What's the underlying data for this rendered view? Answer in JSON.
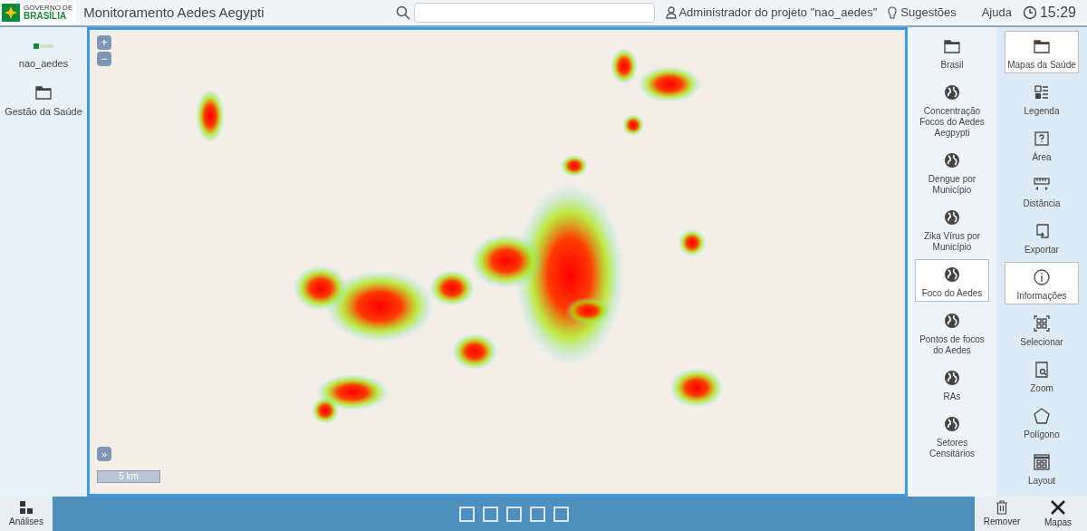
{
  "header": {
    "logo_top": "GOVERNO DE",
    "logo_bottom": "BRASÍLIA",
    "title": "Monitoramento Aedes Aegypti",
    "user": "Administrador do projeto \"nao_aedes\"",
    "suggestions": "Sugestões",
    "help": "Ajuda",
    "time": "15:29"
  },
  "sidebar": {
    "project": "nao_aedes",
    "items": [
      {
        "label": "Gestão da Saúde",
        "kind": "folder"
      }
    ]
  },
  "map": {
    "zoom_in": "+",
    "zoom_out": "−",
    "expand": "»",
    "scale": "5 km"
  },
  "layers": [
    {
      "label": "Brasil",
      "kind": "folder",
      "selected": false
    },
    {
      "label": "Concentração Focos do Aedes Aegpypti",
      "kind": "layer",
      "selected": false
    },
    {
      "label": "Dengue por Município",
      "kind": "layer",
      "selected": false
    },
    {
      "label": "Zika Vírus por Município",
      "kind": "layer",
      "selected": false
    },
    {
      "label": "Foco do Aedes",
      "kind": "layer",
      "selected": true
    },
    {
      "label": "Pontos de focos do Aedes",
      "kind": "layer",
      "selected": false
    },
    {
      "label": "RAs",
      "kind": "layer",
      "selected": false
    },
    {
      "label": "Setores Censitários",
      "kind": "layer",
      "selected": false
    }
  ],
  "tools": [
    {
      "label": "Mapas da Saúde",
      "kind": "folder",
      "selected": true
    },
    {
      "label": "Legenda",
      "kind": "legend",
      "selected": false
    },
    {
      "label": "Área",
      "kind": "area",
      "selected": false
    },
    {
      "label": "Distância",
      "kind": "distance",
      "selected": false
    },
    {
      "label": "Exportar",
      "kind": "export",
      "selected": false
    },
    {
      "label": "Informações",
      "kind": "info",
      "selected": true
    },
    {
      "label": "Selecionar",
      "kind": "select",
      "selected": false
    },
    {
      "label": "Zoom",
      "kind": "zoom",
      "selected": false
    },
    {
      "label": "Polígono",
      "kind": "polygon",
      "selected": false
    },
    {
      "label": "Layout",
      "kind": "layout",
      "selected": false
    }
  ],
  "footer": {
    "analyses": "Análises",
    "pages": [
      {
        "selected": false
      },
      {
        "selected": false
      },
      {
        "selected": false
      },
      {
        "selected": false
      },
      {
        "selected": false
      }
    ],
    "remove": "Remover",
    "maps": "Mapas"
  }
}
